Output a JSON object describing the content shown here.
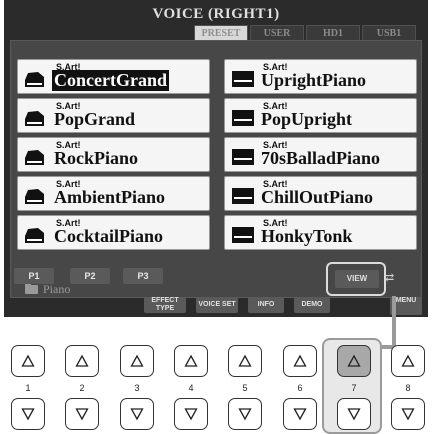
{
  "screen": {
    "title": "VOICE (RIGHT1)",
    "tabs": [
      {
        "label": "PRESET",
        "active": true
      },
      {
        "label": "USER",
        "active": false
      },
      {
        "label": "HD1",
        "active": false
      },
      {
        "label": "USB1",
        "active": false
      }
    ]
  },
  "voices": {
    "left": [
      {
        "badge": "S.Art!",
        "name": "ConcertGrand",
        "selected": true
      },
      {
        "badge": "S.Art!",
        "name": "PopGrand"
      },
      {
        "badge": "S.Art!",
        "name": "RockPiano"
      },
      {
        "badge": "S.Art!",
        "name": "AmbientPiano"
      },
      {
        "badge": "S.Art!",
        "name": "CocktailPiano"
      }
    ],
    "right": [
      {
        "badge": "S.Art!",
        "name": "UprightPiano"
      },
      {
        "badge": "S.Art!",
        "name": "PopUpright"
      },
      {
        "badge": "S.Art!",
        "name": "70sBalladPiano"
      },
      {
        "badge": "S.Art!",
        "name": "ChillOutPiano"
      },
      {
        "badge": "S.Art!",
        "name": "HonkyTonk"
      }
    ]
  },
  "folder": {
    "label": "Piano",
    "icon": "folder-icon"
  },
  "page_buttons": [
    "P1",
    "P2",
    "P3"
  ],
  "function_buttons": [
    {
      "label": "EFFECT TYPE"
    },
    {
      "label": "VOICE SET"
    },
    {
      "label": "INFO"
    },
    {
      "label": "DEMO"
    }
  ],
  "view_button": {
    "label": "VIEW"
  },
  "menu_button": {
    "label": "MENU"
  },
  "hardware_buttons": {
    "numbers": [
      "1",
      "2",
      "3",
      "4",
      "5",
      "6",
      "7",
      "8"
    ],
    "pressed_index": 7
  },
  "colors": {
    "screen_bg": "#2b2b2b",
    "panel_bg": "#474747",
    "pressed": "#a8a8a8"
  }
}
